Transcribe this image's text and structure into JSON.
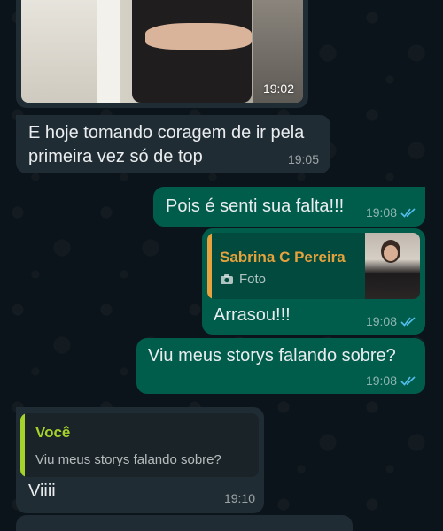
{
  "messages": [
    {
      "id": "photo",
      "direction": "incoming",
      "time": "19:02"
    },
    {
      "id": "m1",
      "direction": "incoming",
      "text_line1": "E hoje tomando coragem de ir pela",
      "text_line2": "primeira vez só de top",
      "time": "19:05"
    },
    {
      "id": "m2",
      "direction": "outgoing",
      "text": "Pois é senti sua falta!!!",
      "time": "19:08",
      "status": "read"
    },
    {
      "id": "m3",
      "direction": "outgoing",
      "quote": {
        "name": "Sabrina C Pereira",
        "label": "Foto",
        "icon": "camera-icon"
      },
      "text": "Arrasou!!!",
      "time": "19:08",
      "status": "read"
    },
    {
      "id": "m4",
      "direction": "outgoing",
      "text": "Viu meus storys falando sobre?",
      "time": "19:08",
      "status": "read"
    },
    {
      "id": "m5",
      "direction": "incoming",
      "quote": {
        "name": "Você",
        "text": "Viu meus storys falando sobre?"
      },
      "text": "Viiii",
      "time": "19:10"
    }
  ],
  "colors": {
    "background": "#0b141a",
    "incoming_bubble": "#202c33",
    "outgoing_bubble": "#005c4b",
    "read_ticks": "#53bdeb",
    "quote_sabrina": "#e6a23c",
    "quote_voce": "#a5d22a"
  }
}
